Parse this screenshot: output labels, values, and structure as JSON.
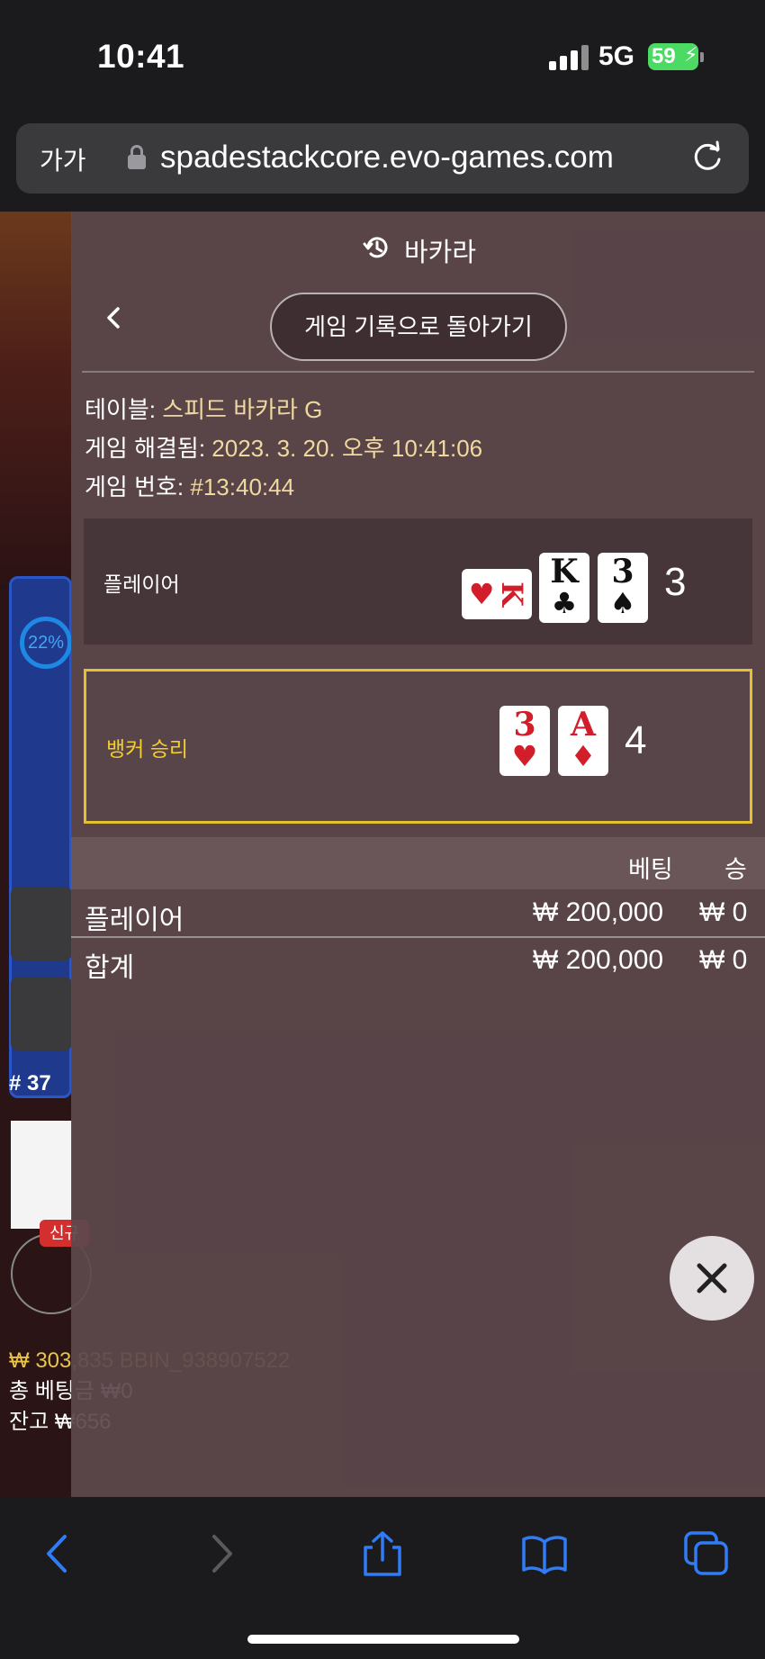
{
  "status_bar": {
    "time": "10:41",
    "network": "5G",
    "battery": "59"
  },
  "browser": {
    "text_size_label": "가가",
    "url": "spadestackcore.evo-games.com"
  },
  "background_game": {
    "progress_text": "22%",
    "round_label": "# 37",
    "new_badge": "신규",
    "balance_line": "₩ 303,835 BBIN_938907522",
    "total_bet_line": "총 베팅금 ₩0",
    "remaining_line": "잔고 ₩656"
  },
  "panel": {
    "title": "바카라",
    "back_to_history_label": "게임 기록으로 돌아가기",
    "table_label": "테이블:",
    "table_value": "스피드 바카라 G",
    "resolved_label": "게임 해결됨:",
    "resolved_value": "2023. 3. 20. 오후 10:41:06",
    "game_number_label": "게임 번호:",
    "game_number_value": "#13:40:44",
    "player_hand": {
      "label": "플레이어",
      "total": "3",
      "cards": [
        {
          "rank": "K",
          "suit": "♥",
          "color": "red",
          "sideways": true
        },
        {
          "rank": "K",
          "suit": "♣",
          "color": "black"
        },
        {
          "rank": "3",
          "suit": "♠",
          "color": "black"
        }
      ]
    },
    "banker_hand": {
      "label": "뱅커 승리",
      "total": "4",
      "highlight_color": "#e6c12f",
      "cards": [
        {
          "rank": "3",
          "suit": "♥",
          "color": "red"
        },
        {
          "rank": "A",
          "suit": "♦",
          "color": "red"
        }
      ]
    },
    "bets": {
      "headers": {
        "bet": "베팅",
        "win": "승"
      },
      "rows": [
        {
          "name": "플레이어",
          "bet": "₩ 200,000",
          "win": "₩ 0"
        },
        {
          "name": "합계",
          "bet": "₩ 200,000",
          "win": "₩ 0"
        }
      ]
    }
  },
  "icons": {
    "history": "history-icon",
    "back": "chevron-left-icon",
    "close": "close-icon",
    "lock": "lock-icon",
    "reload": "reload-icon"
  },
  "colors": {
    "winner_highlight": "#e6c12f",
    "winner_label": "#f4cd2a",
    "safari_blue": "#2f7cf6",
    "battery_green": "#4cd964"
  }
}
